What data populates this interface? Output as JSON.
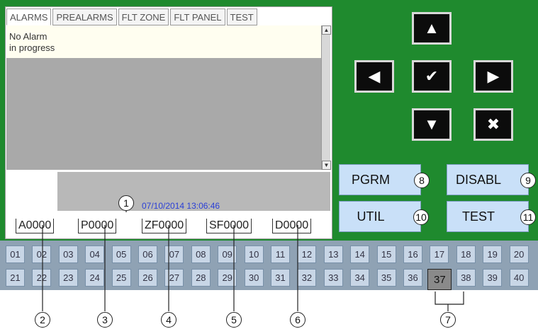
{
  "tabs": [
    "ALARMS",
    "PREALARMS",
    "FLT ZONE",
    "FLT PANEL",
    "TEST"
  ],
  "message": [
    "No Alarm",
    "in progress"
  ],
  "datetime": "07/10/2014 13:06:46",
  "counters": [
    "A0000",
    "P0000",
    "ZF0000",
    "SF0000",
    "D0000"
  ],
  "nav": {
    "up": "▲",
    "down": "▼",
    "left": "◀",
    "right": "▶",
    "ok": "✔",
    "cancel": "✖"
  },
  "buttons": {
    "pgrm": "PGRM",
    "disabl": "DISABL",
    "util": "UTIL",
    "test": "TEST"
  },
  "zones_row1": [
    "01",
    "02",
    "03",
    "04",
    "05",
    "06",
    "07",
    "08",
    "09",
    "10",
    "11",
    "12",
    "13",
    "14",
    "15",
    "16",
    "17",
    "18",
    "19",
    "20"
  ],
  "zones_row2": [
    "21",
    "22",
    "23",
    "24",
    "25",
    "26",
    "27",
    "28",
    "29",
    "30",
    "31",
    "32",
    "33",
    "34",
    "35",
    "36",
    "37",
    "38",
    "39",
    "40"
  ],
  "selected_zone": "37",
  "callouts": [
    "1",
    "2",
    "3",
    "4",
    "5",
    "6",
    "7",
    "8",
    "9",
    "10",
    "11"
  ],
  "colors": {
    "panel": "#1f8a2e",
    "accent_datetime": "#2a3fd6",
    "button_bg": "#c9e0f8"
  }
}
